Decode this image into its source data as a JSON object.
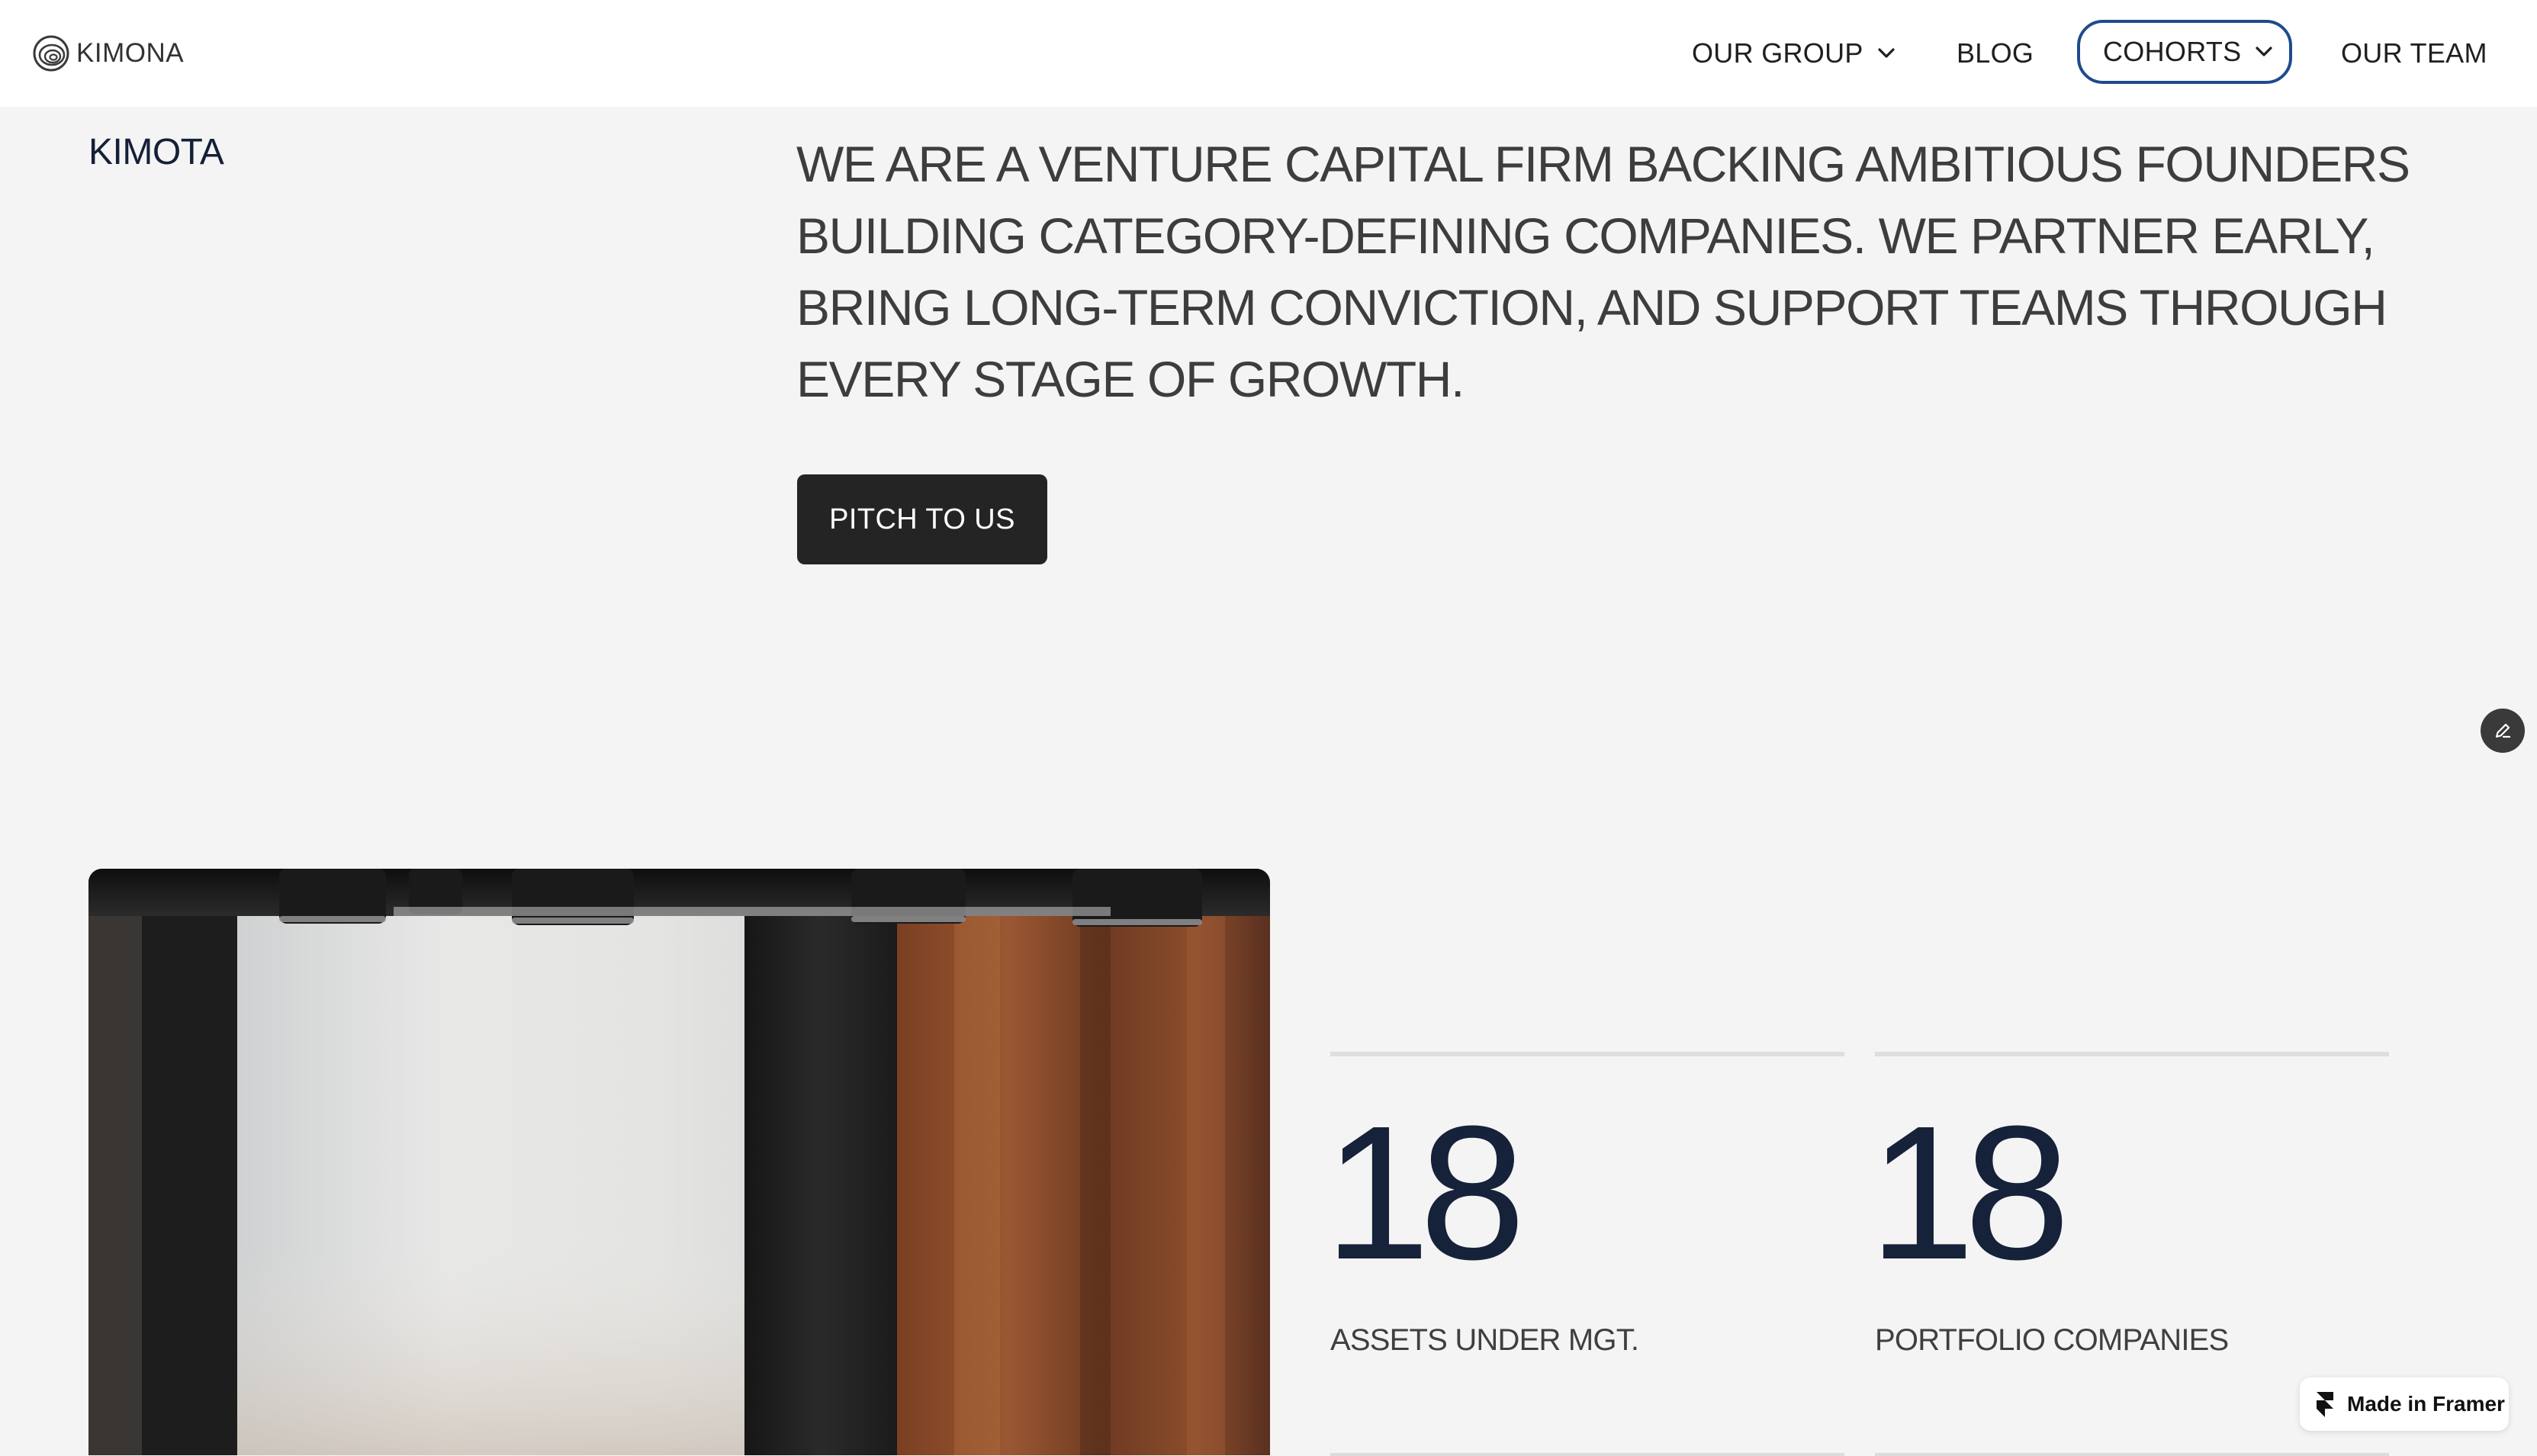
{
  "header": {
    "logo_text": "KIMONA",
    "nav": {
      "our_group": "OUR GROUP",
      "blog": "BLOG",
      "cohorts": "COHORTS",
      "our_team": "OUR TEAM"
    }
  },
  "hero": {
    "brand": "KIMOTA",
    "headline": "WE ARE A VENTURE CAPITAL FIRM BACKING AMBITIOUS FOUNDERS BUILDING CATEGORY-DEFINING COMPANIES. WE PARTNER EARLY, BRING LONG-TERM CONVICTION, AND SUPPORT TEAMS THROUGH EVERY STAGE OF GROWTH.",
    "cta_label": "PITCH TO US"
  },
  "stats": [
    {
      "value": "18",
      "label": "ASSETS UNDER MGT."
    },
    {
      "value": "18",
      "label": "PORTFOLIO COMPANIES"
    }
  ],
  "badge": {
    "label": "Made in Framer"
  },
  "colors": {
    "background": "#f4f4f4",
    "header_bg": "#ffffff",
    "accent_outline": "#1e4b8c",
    "button_bg": "#242424",
    "stat_number": "#16213a"
  }
}
